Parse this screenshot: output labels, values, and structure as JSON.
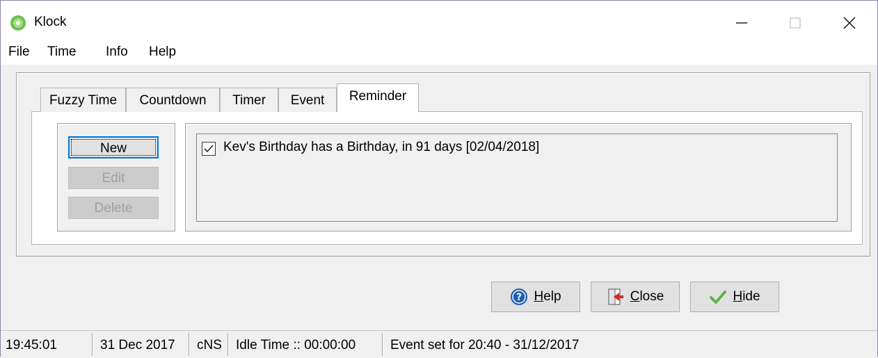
{
  "window": {
    "title": "Klock",
    "icon": "klock-app-icon"
  },
  "menubar": {
    "items": [
      "File",
      "Time",
      "Info",
      "Help"
    ]
  },
  "tabs": [
    {
      "label": "Fuzzy Time",
      "active": false
    },
    {
      "label": "Countdown",
      "active": false
    },
    {
      "label": "Timer",
      "active": false
    },
    {
      "label": "Event",
      "active": false
    },
    {
      "label": "Reminder",
      "active": true
    }
  ],
  "reminder": {
    "buttons": {
      "new": "New",
      "edit": "Edit",
      "delete": "Delete"
    },
    "items": [
      {
        "checked": true,
        "text": "Kev's Birthday has a Birthday, in  91 days [02/04/2018]"
      }
    ]
  },
  "actions": {
    "help": {
      "accel": "H",
      "rest": "elp",
      "icon": "help-icon"
    },
    "close": {
      "accel": "C",
      "rest": "lose",
      "icon": "exit-door-icon"
    },
    "hide": {
      "accel": "H",
      "rest": "ide",
      "icon": "checkmark-icon"
    }
  },
  "statusbar": {
    "time": "19:45:01",
    "date": "31 Dec 2017",
    "mode": "cNS",
    "idle": "Idle Time :: 00:00:00",
    "event": "Event set for 20:40 - 31/12/2017"
  },
  "colors": {
    "accent": "#0078d7",
    "icon_green": "#6cc04a",
    "help_blue": "#1e5fb4",
    "close_red": "#d42a2a",
    "hide_green": "#5ab546"
  }
}
